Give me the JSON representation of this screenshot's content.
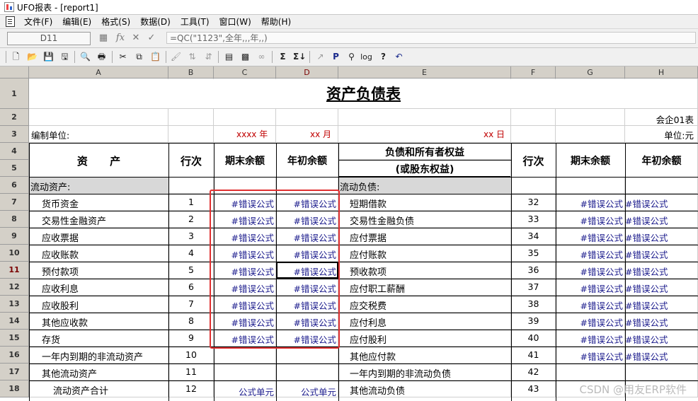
{
  "window": {
    "title": "UFO报表 - [report1]"
  },
  "menu": [
    "文件(F)",
    "编辑(E)",
    "格式(S)",
    "数据(D)",
    "工具(T)",
    "窗口(W)",
    "帮助(H)"
  ],
  "formula_bar": {
    "cell_ref": "D11",
    "fx": "fx",
    "cancel": "✕",
    "confirm": "✓",
    "formula": "=QC(\"1123\",全年,,,年,,)"
  },
  "toolbar": {
    "file": [
      "new",
      "open",
      "save",
      "save-as"
    ],
    "print": [
      "print-preview",
      "print"
    ],
    "edit": [
      "cut",
      "copy",
      "paste"
    ],
    "tools": [
      "format-painter",
      "sort-asc",
      "sort-desc",
      "insert-function",
      "merge-cells",
      "binoculars",
      "sum",
      "sum-all",
      "chart",
      "bold-p",
      "print-setup",
      "log",
      "help",
      "undo"
    ]
  },
  "toolbar_glyphs": {
    "sum": "Σ",
    "sum-all": "Σ↓",
    "bold-p": "P",
    "log": "log",
    "help": "?",
    "undo": "↶"
  },
  "columns": [
    "A",
    "B",
    "C",
    "D",
    "E",
    "F",
    "G",
    "H"
  ],
  "rows": [
    "1",
    "2",
    "3",
    "4",
    "5",
    "6",
    "7",
    "8",
    "9",
    "10",
    "11",
    "12",
    "13",
    "14",
    "15",
    "16",
    "17",
    "18"
  ],
  "active": {
    "column": "D",
    "row": "11"
  },
  "sheet": {
    "title": "资产负债表",
    "form_no": "会企01表",
    "compiler": "编制单位:",
    "year_mark": "xxxx 年",
    "month_mark": "xx 月",
    "day_mark": "xx 日",
    "unit": "单位:元",
    "hdr_asset": "资      产",
    "hdr_line": "行次",
    "hdr_end": "期末余额",
    "hdr_begin": "年初余额",
    "hdr_liab_1": "负债和所有者权益",
    "hdr_liab_2": "(或股东权益)",
    "section_asset": "流动资产:",
    "section_liab": "流动负债:",
    "err": "#错误公式",
    "formula_unit": "公式单元"
  },
  "assets": [
    {
      "name": "货币资金",
      "line": "1"
    },
    {
      "name": "交易性金融资产",
      "line": "2"
    },
    {
      "name": "应收票据",
      "line": "3"
    },
    {
      "name": "应收账款",
      "line": "4"
    },
    {
      "name": "预付款项",
      "line": "5"
    },
    {
      "name": "应收利息",
      "line": "6"
    },
    {
      "name": "应收股利",
      "line": "7"
    },
    {
      "name": "其他应收款",
      "line": "8"
    },
    {
      "name": "存货",
      "line": "9"
    },
    {
      "name": "一年内到期的非流动资产",
      "line": "10"
    },
    {
      "name": "其他流动资产",
      "line": "11"
    },
    {
      "name": "流动资产合计",
      "line": "12"
    }
  ],
  "liabilities": [
    {
      "name": "短期借款",
      "line": "32"
    },
    {
      "name": "交易性金融负债",
      "line": "33"
    },
    {
      "name": "应付票据",
      "line": "34"
    },
    {
      "name": "应付账款",
      "line": "35"
    },
    {
      "name": "预收款项",
      "line": "36"
    },
    {
      "name": "应付职工薪酬",
      "line": "37"
    },
    {
      "name": "应交税费",
      "line": "38"
    },
    {
      "name": "应付利息",
      "line": "39"
    },
    {
      "name": "应付股利",
      "line": "40"
    },
    {
      "name": "其他应付款",
      "line": "41"
    },
    {
      "name": "一年内到期的非流动负债",
      "line": "42"
    },
    {
      "name": "其他流动负债",
      "line": "43"
    }
  ],
  "watermark": "CSDN @用友ERP软件",
  "colors": {
    "error_text": "#1a1a8c",
    "date_marks": "#c00000",
    "highlight_box": "#e03030",
    "section_fill": "#d8d8d8"
  }
}
